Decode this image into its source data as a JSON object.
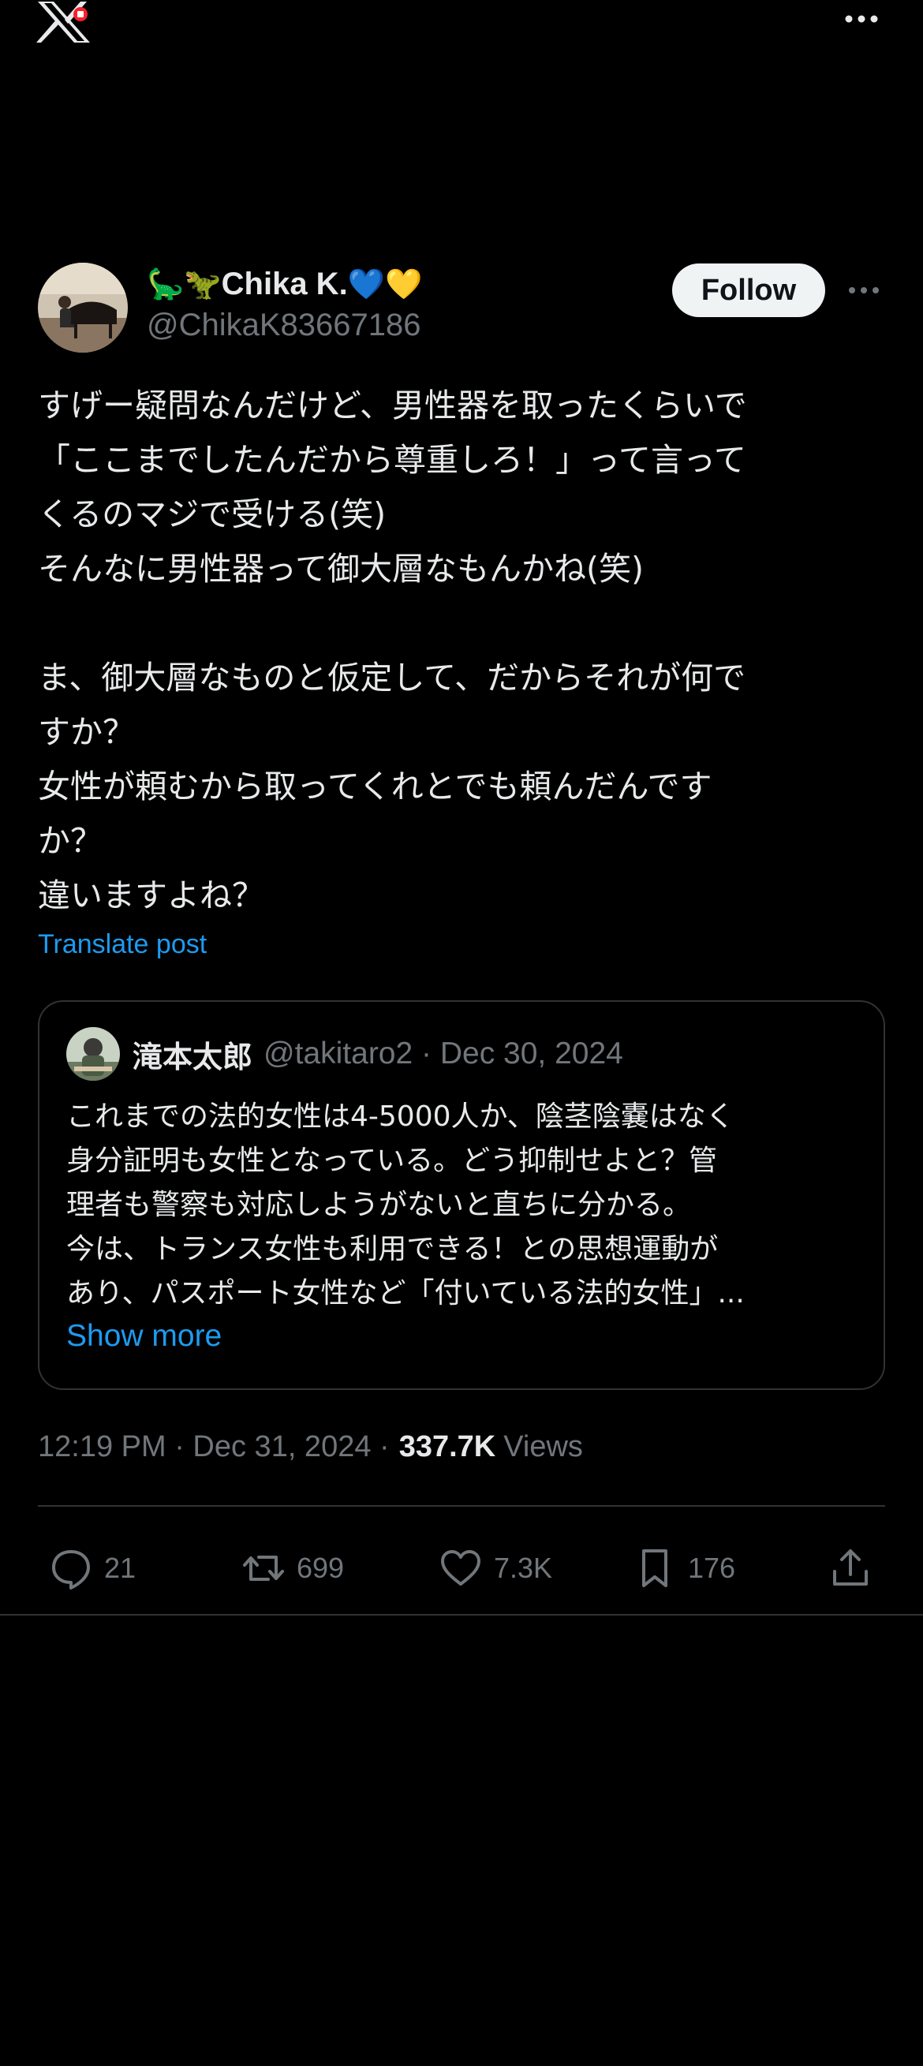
{
  "topbar": {
    "logo_icon": "x-logo-icon",
    "more_icon": "more-horizontal-icon"
  },
  "post": {
    "author": {
      "emoji_prefix": "🦕🦖",
      "name": "Chika K.",
      "emoji_suffix": "💙💛",
      "handle": "@ChikaK83667186"
    },
    "follow_label": "Follow",
    "text": "すげー疑問なんだけど、男性器を取ったくらいで\n「ここまでしたんだから尊重しろ！」って言って\nくるのマジで受ける(笑)\nそんなに男性器って御大層なもんかね(笑)\n\nま、御大層なものと仮定して、だからそれが何で\nすか？\n女性が頼むから取ってくれとでも頼んだんです\nか？\n違いますよね？",
    "translate_label": "Translate post",
    "quote": {
      "name": "滝本太郎",
      "meta": "@takitaro2 · Dec 30, 2024",
      "text": "これまでの法的女性は4-5000人か、陰茎陰嚢はなく\n身分証明も女性となっている。どう抑制せよと？管\n理者も警察も対応しようがないと直ちに分かる。\n今は、トランス女性も利用できる！との思想運動が\nあり、パスポート女性など「付いている法的女性」...",
      "show_more": "Show more"
    },
    "timestamp": "12:19 PM · Dec 31, 2024 ·",
    "views_count": "337.7K",
    "views_label": "Views",
    "actions": {
      "replies": "21",
      "reposts": "699",
      "likes": "7.3K",
      "bookmarks": "176"
    },
    "colors": {
      "accent": "#1d9bf0",
      "muted": "#71767b",
      "divider": "#2f3336",
      "text": "#e7e9ea"
    }
  }
}
